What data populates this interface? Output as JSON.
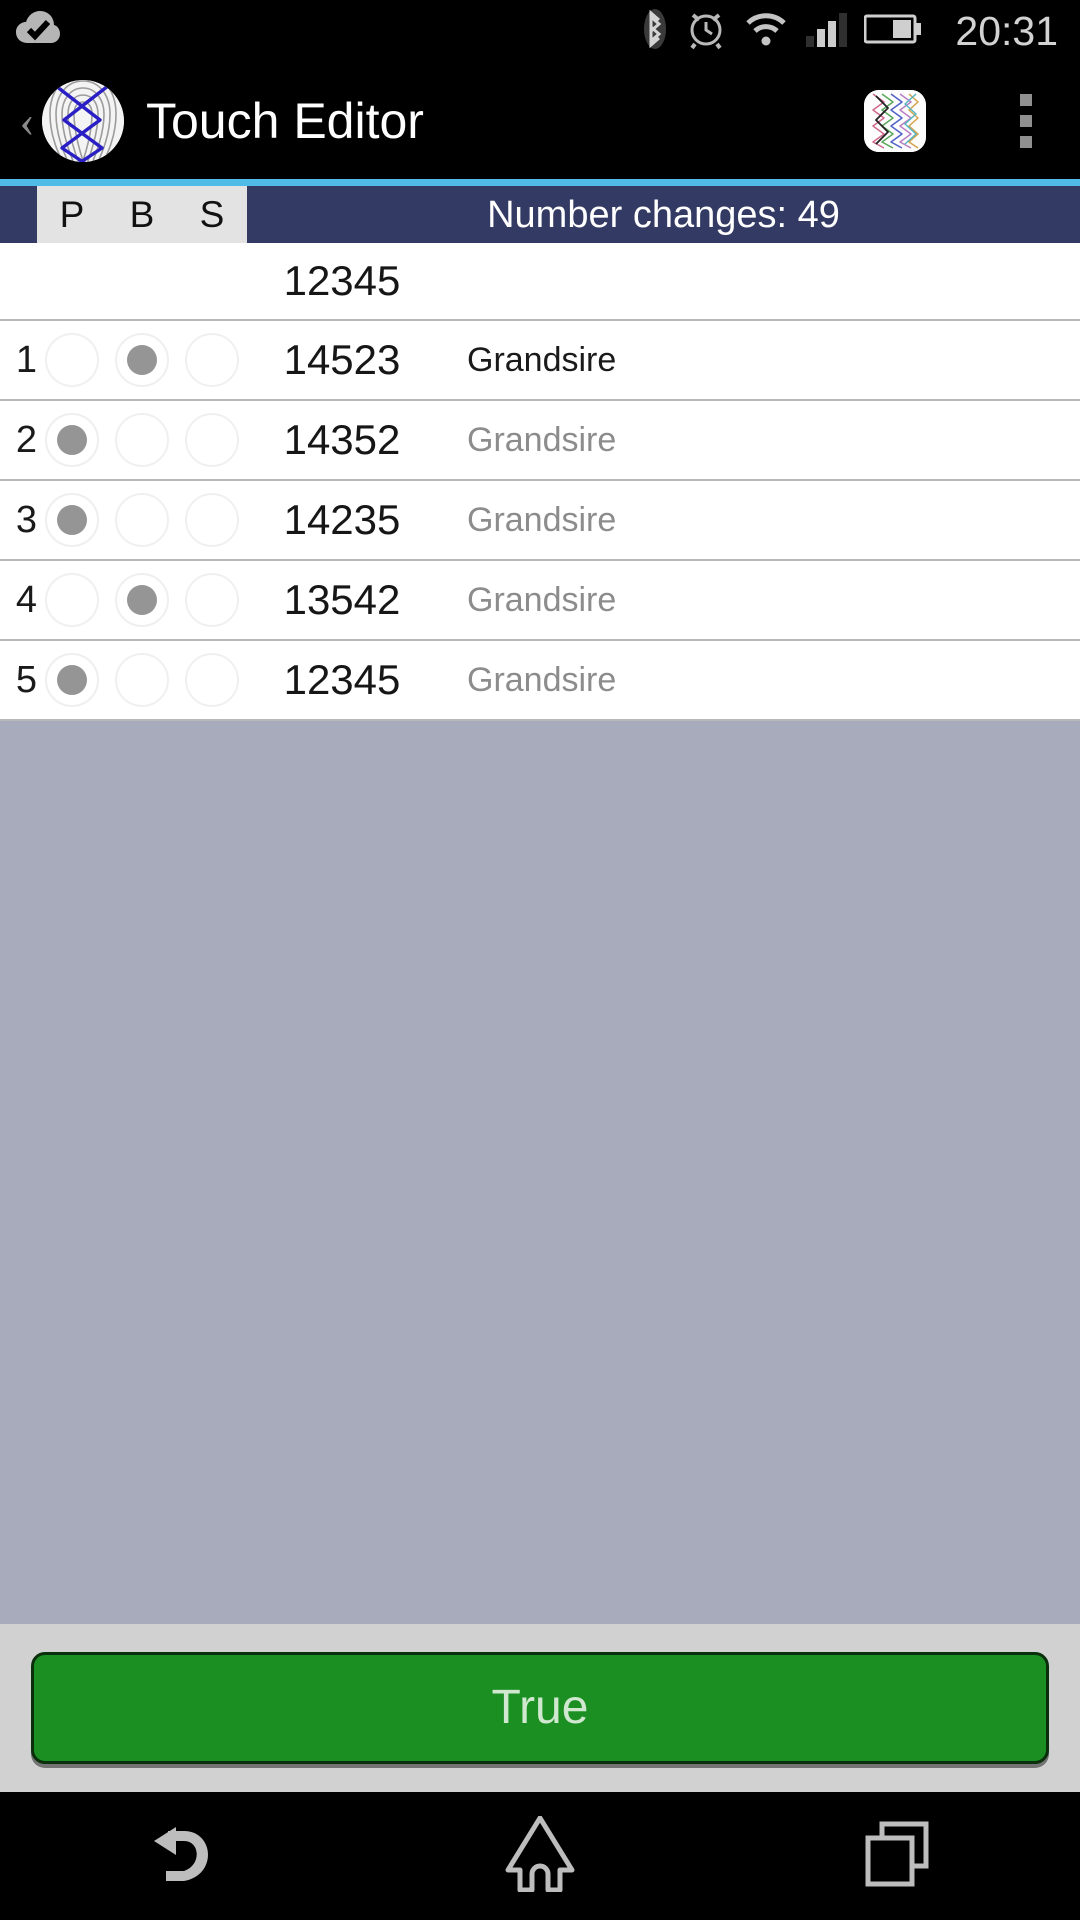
{
  "status_bar": {
    "notification_icon": "cloud-check-icon",
    "icons": [
      "bluetooth-icon",
      "alarm-clock-icon",
      "wifi-icon",
      "signal-bars-icon",
      "battery-icon"
    ],
    "clock": "20:31",
    "battery_level_percent": 40
  },
  "toolbar": {
    "back_label": "‹",
    "app_icon": "fingerprint-method-icon",
    "title": "Touch Editor",
    "method_diagram_icon": "blue-line-diagram-icon",
    "overflow_icon": "overflow-menu-icon"
  },
  "accent_color": "#51bbe8",
  "column_header": {
    "columns": [
      "P",
      "B",
      "S"
    ],
    "changes_label": "Number changes: 49"
  },
  "table": {
    "rounds_row": {
      "row": "12345"
    },
    "rows": [
      {
        "num": "1",
        "p": false,
        "b": true,
        "s": false,
        "row": "14523",
        "method": "Grandsire",
        "method_strong": true
      },
      {
        "num": "2",
        "p": true,
        "b": false,
        "s": false,
        "row": "14352",
        "method": "Grandsire",
        "method_strong": false
      },
      {
        "num": "3",
        "p": true,
        "b": false,
        "s": false,
        "row": "14235",
        "method": "Grandsire",
        "method_strong": false
      },
      {
        "num": "4",
        "p": false,
        "b": true,
        "s": false,
        "row": "13542",
        "method": "Grandsire",
        "method_strong": false
      },
      {
        "num": "5",
        "p": true,
        "b": false,
        "s": false,
        "row": "12345",
        "method": "Grandsire",
        "method_strong": false
      }
    ]
  },
  "footer": {
    "true_button_label": "True",
    "true_button_color": "#1b8f22"
  },
  "nav_bar": {
    "back_icon": "back-arrow-icon",
    "home_icon": "home-icon",
    "recents_icon": "recent-apps-icon"
  }
}
